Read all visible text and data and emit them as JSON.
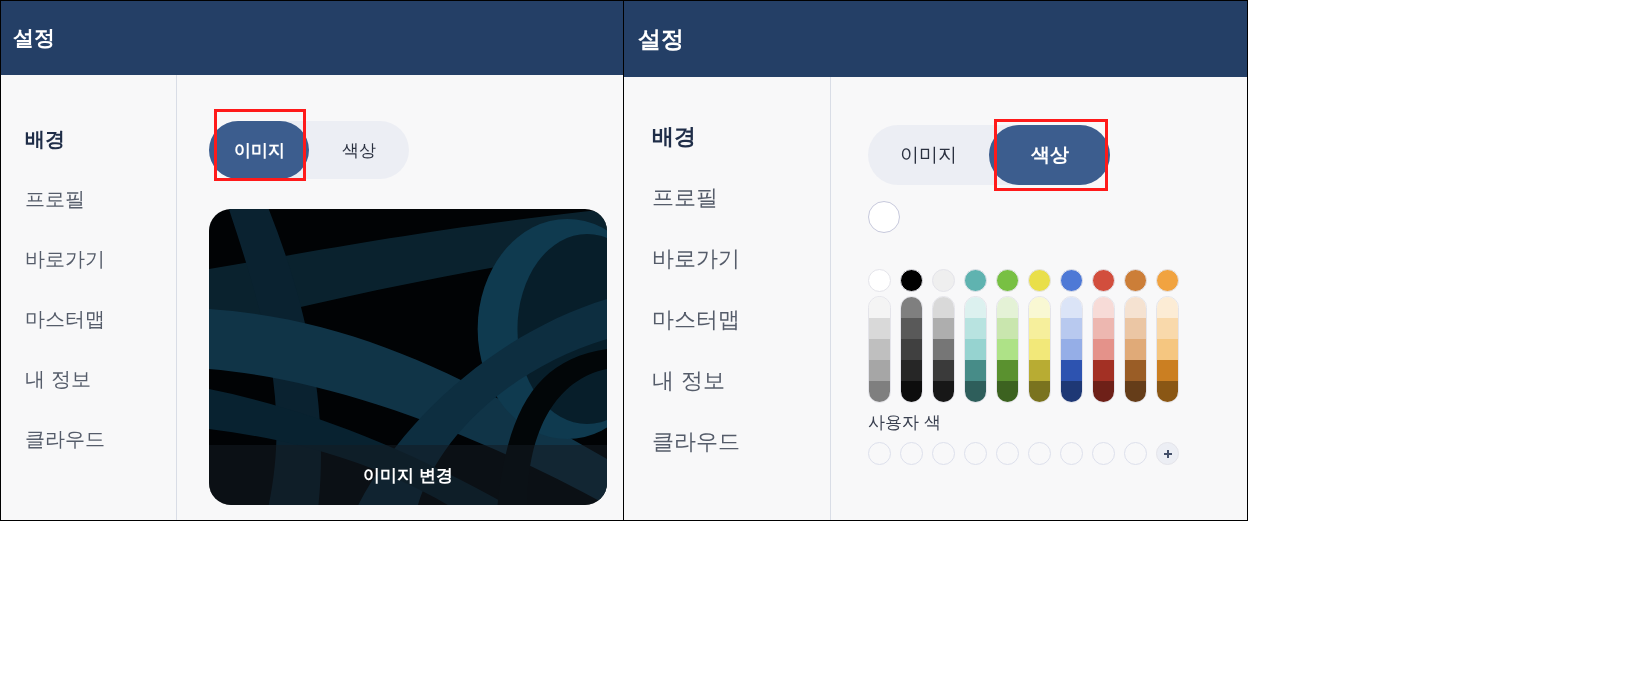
{
  "panels": [
    {
      "title": "설정",
      "sidebar": [
        {
          "label": "배경",
          "selected": true
        },
        {
          "label": "프로필",
          "selected": false
        },
        {
          "label": "바로가기",
          "selected": false
        },
        {
          "label": "마스터맵",
          "selected": false
        },
        {
          "label": "내 정보",
          "selected": false
        },
        {
          "label": "클라우드",
          "selected": false
        }
      ],
      "tabs": [
        {
          "label": "이미지",
          "selected": true,
          "highlighted": true
        },
        {
          "label": "색상",
          "selected": false,
          "highlighted": false
        }
      ],
      "image": {
        "kind": "picture",
        "button": "이미지 변경"
      }
    },
    {
      "title": "설정",
      "kind": "color",
      "sidebar": [
        {
          "label": "배경",
          "selected": true
        },
        {
          "label": "프로필",
          "selected": false
        },
        {
          "label": "바로가기",
          "selected": false
        },
        {
          "label": "마스터맵",
          "selected": false
        },
        {
          "label": "내 정보",
          "selected": false
        },
        {
          "label": "클라우드",
          "selected": false
        }
      ],
      "tabs": [
        {
          "label": "이미지",
          "selected": false,
          "highlighted": false
        },
        {
          "label": "색상",
          "selected": true,
          "highlighted": true
        }
      ],
      "current_color": {
        "filled": false
      },
      "palette": [
        {
          "color": "#ffffff",
          "shades": [
            {
              "color": "#f4f4f4"
            },
            {
              "color": "#d9d9d9"
            },
            {
              "color": "#bfbfbf"
            },
            {
              "color": "#a6a6a6"
            },
            {
              "color": "#7f7f7f"
            }
          ]
        },
        {
          "color": "#000000",
          "shades": [
            {
              "color": "#7f7f7f"
            },
            {
              "color": "#595959"
            },
            {
              "color": "#404040"
            },
            {
              "color": "#262626"
            },
            {
              "color": "#0d0d0d"
            }
          ]
        },
        {
          "color": "#efefef",
          "shades": [
            {
              "color": "#d9d9d9"
            },
            {
              "color": "#aeaeae"
            },
            {
              "color": "#767676"
            },
            {
              "color": "#3a3a3a"
            },
            {
              "color": "#171717"
            }
          ]
        },
        {
          "color": "#5fb3b0",
          "shades": [
            {
              "color": "#dcf1ef"
            },
            {
              "color": "#b8e3e0"
            },
            {
              "color": "#96d3d0"
            },
            {
              "color": "#478c88"
            },
            {
              "color": "#2e5e5b"
            }
          ]
        },
        {
          "color": "#78c043",
          "shades": [
            {
              "color": "#e4f2d6"
            },
            {
              "color": "#c9e6ae"
            },
            {
              "color": "#aee287"
            },
            {
              "color": "#5a912f"
            },
            {
              "color": "#3c6220"
            }
          ]
        },
        {
          "color": "#e9df4a",
          "shades": [
            {
              "color": "#f9f8d3"
            },
            {
              "color": "#f6ef9c"
            },
            {
              "color": "#f2e879"
            },
            {
              "color": "#b8ac33"
            },
            {
              "color": "#7a731f"
            }
          ]
        },
        {
          "color": "#4e79d6",
          "shades": [
            {
              "color": "#dbe4f7"
            },
            {
              "color": "#b8c9ef"
            },
            {
              "color": "#95aee7"
            },
            {
              "color": "#2d53b0"
            },
            {
              "color": "#1e3875"
            }
          ]
        },
        {
          "color": "#d24e3d",
          "shades": [
            {
              "color": "#f7dbd7"
            },
            {
              "color": "#edb7b0"
            },
            {
              "color": "#e4928a"
            },
            {
              "color": "#a33024"
            },
            {
              "color": "#6e2018"
            }
          ]
        },
        {
          "color": "#cc7e38",
          "shades": [
            {
              "color": "#f5e2d1"
            },
            {
              "color": "#ebc6a4"
            },
            {
              "color": "#e0aa78"
            },
            {
              "color": "#9a5d26"
            },
            {
              "color": "#653d19"
            }
          ]
        },
        {
          "color": "#f1a340",
          "shades": [
            {
              "color": "#fcecd5"
            },
            {
              "color": "#f9d9ab"
            },
            {
              "color": "#f5c680"
            },
            {
              "color": "#cb7f22"
            },
            {
              "color": "#8a5715"
            }
          ]
        }
      ],
      "custom_label": "사용자 색",
      "custom_colors": [
        {
          "filled": false
        },
        {
          "filled": false
        },
        {
          "filled": false
        },
        {
          "filled": false
        },
        {
          "filled": false
        },
        {
          "filled": false
        },
        {
          "filled": false
        },
        {
          "filled": false
        },
        {
          "filled": false
        }
      ]
    }
  ]
}
